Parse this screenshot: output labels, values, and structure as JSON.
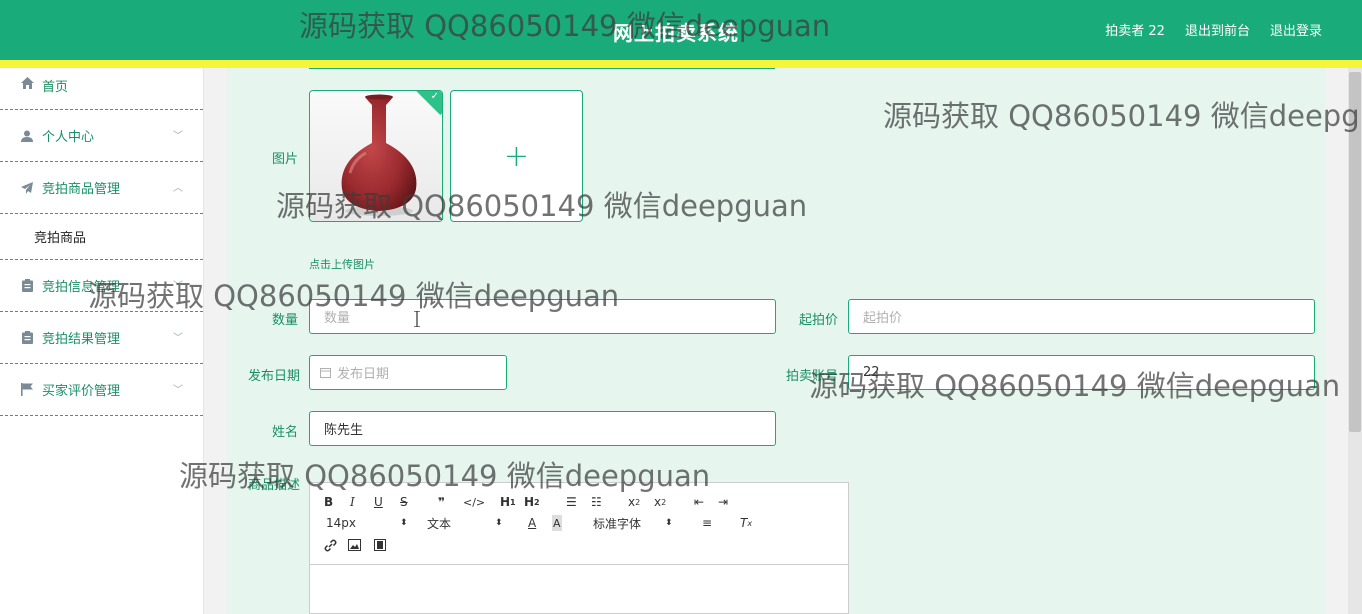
{
  "header": {
    "title": "网上拍卖系统",
    "links": [
      "拍卖者 22",
      "退出到前台",
      "退出登录"
    ]
  },
  "sidebar": {
    "items": [
      {
        "label": "首页",
        "icon": "home-icon"
      },
      {
        "label": "个人中心",
        "icon": "user-icon"
      },
      {
        "label": "竞拍商品管理",
        "icon": "send-icon",
        "sub": "竞拍商品"
      },
      {
        "label": "竞拍信息管理",
        "icon": "clipboard-icon"
      },
      {
        "label": "竞拍结果管理",
        "icon": "clipboard-icon"
      },
      {
        "label": "买家评价管理",
        "icon": "flag-icon"
      }
    ]
  },
  "form": {
    "image_label": "图片",
    "upload_tip": "点击上传图片",
    "quantity_label": "数量",
    "quantity_placeholder": "数量",
    "start_price_label": "起拍价",
    "start_price_placeholder": "起拍价",
    "publish_date_label": "发布日期",
    "publish_date_placeholder": "发布日期",
    "seller_label": "拍卖账号",
    "seller_value": "22",
    "name_label": "姓名",
    "name_value": "陈先生",
    "desc_label": "商品描述"
  },
  "editor": {
    "font_size": "14px",
    "paragraph": "文本",
    "font_family": "标准字体"
  },
  "watermark": "源码获取 QQ86050149 微信deepguan",
  "colors": {
    "primary": "#1aab7a",
    "accent_bar": "#f5f53a",
    "panel_bg": "#e6f6ef"
  }
}
